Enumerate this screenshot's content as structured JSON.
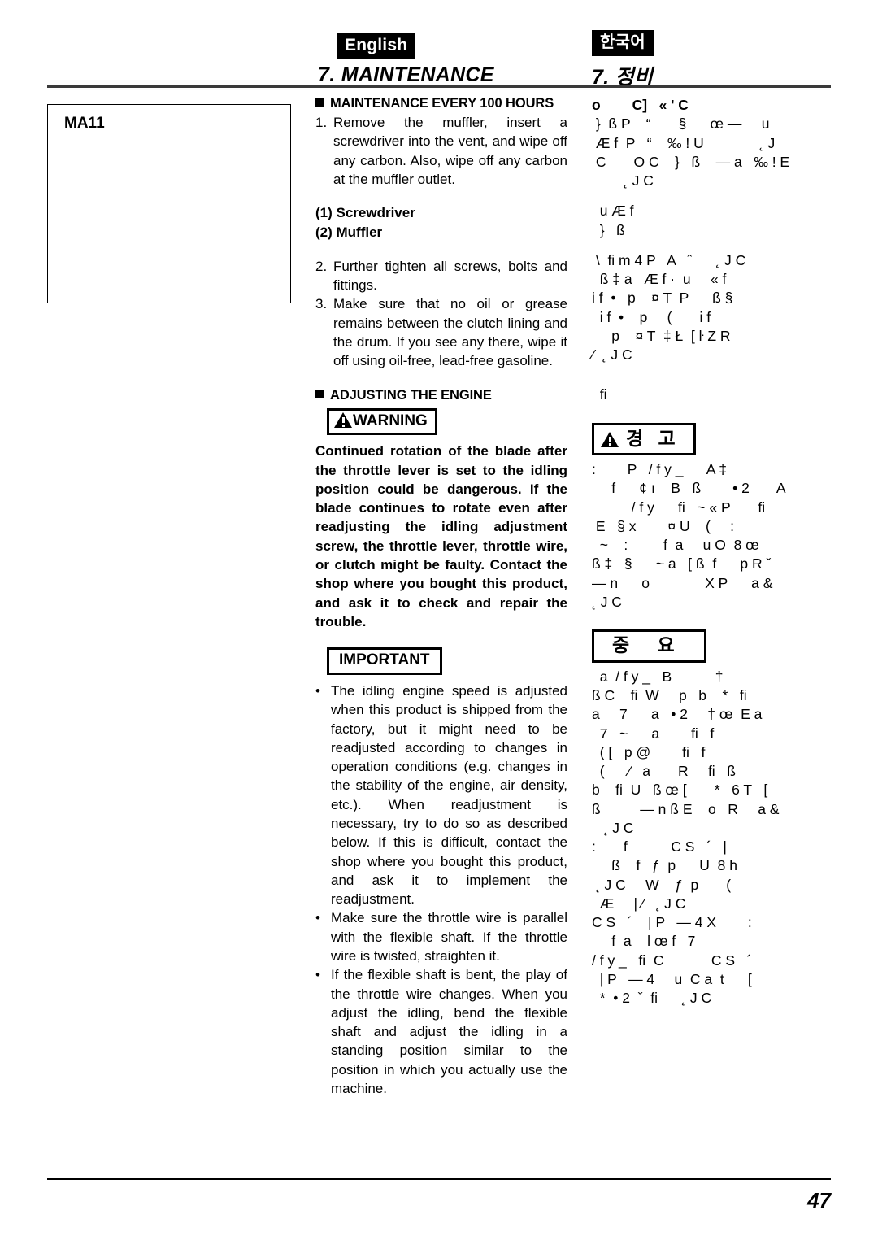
{
  "header": {
    "english_tag": "English",
    "korean_tag": "한국어",
    "english_chapter": "7. MAINTENANCE",
    "korean_chapter": "7. 정비"
  },
  "figure": {
    "label": "MA11"
  },
  "english": {
    "section_1_heading": "MAINTENANCE EVERY 100 HOURS",
    "steps": [
      {
        "number": "1.",
        "text": "Remove the muffler, insert a screwdriver into the vent, and wipe off any carbon. Also, wipe off any carbon at the muffler outlet."
      },
      {
        "number": "2.",
        "text": "Further tighten all screws, bolts and fittings."
      },
      {
        "number": "3.",
        "text": "Make sure that no oil or grease remains between the clutch lining and the drum. If you see any there, wipe it off using oil-free, lead-free gasoline."
      }
    ],
    "callouts": [
      "(1) Screwdriver",
      "(2) Muffler"
    ],
    "section_2_heading": "ADJUSTING THE ENGINE",
    "warning_label": "WARNING",
    "warning_text": "Continued rotation of the blade after the throttle lever is set to the idling position could be dangerous. If the blade continues to rotate even after readjusting the idling adjustment screw, the throttle lever, throttle wire, or clutch might be faulty. Contact the shop where you bought this product, and ask it to check and repair the trouble.",
    "important_label": "IMPORTANT",
    "important_bullets": [
      "The idling engine speed is adjusted when this product is shipped from the factory, but it might need to be readjusted according to changes in operation conditions (e.g. changes in the stability of the engine, air density, etc.). When readjustment is necessary, try to do so as described below. If this is difficult, contact the shop where you bought this product, and ask it to implement the readjustment.",
      "Make sure the throttle wire is parallel with the flexible shaft. If the throttle wire is twisted, straighten it.",
      "If the flexible shaft is bent, the play of the throttle wire changes. When you adjust the idling, bend the flexible shaft and adjust the idling in a standing position similar to the position in which you actually use the machine."
    ]
  },
  "korean": {
    "section_1_lines": [
      "o        C]   « ' C",
      " }  ß P    “       §      œ —     u",
      " Æ f  P   “    ‰ ! U              ˛ J",
      " C       O C    }   ß    — a   ‰ ! E",
      "        ˛ J C"
    ],
    "callout_lines": [
      "  u Æ f",
      "  }   ß"
    ],
    "section_2_lines": [
      " \\  fi m 4 P   A   ˆ      ˛ J C",
      "  ß ‡ a   Æ f ·  u     « f",
      "i f  •   p    ¤ T  P      ß §",
      "  i f  •    p     (       i f",
      "     p    ¤ T  ‡ Ł  [ ŀ Z R",
      "⁄  ˛ J C"
    ],
    "section_2_tail": "  fi",
    "warning_label": "경 고",
    "warning_lines": [
      ":        P   / f y _      A ‡",
      "     f      ¢ ı    B   ß        • 2       A",
      "          / f y      fi   ~ « P       fi",
      " E   § x        ¤ U    (     :",
      "  ~    :         f  a     u O  8 œ",
      "ß ‡   §      ~ a   [ ß  f      p R ˇ",
      "— n      o              X P      a &",
      "˛ J C"
    ],
    "important_label": "중 요",
    "important_lines": [
      "  a  / f y _   B           †",
      "ß C    fi  W     p   b    *   fi",
      "a     7      a   • 2     † œ  E a",
      "  7   ~      a        fi   f",
      "  ( [   p @        fi   f",
      "  (      ⁄   a       R     fi   ß",
      "b    fi  U   ß œ [       *   6 T   [",
      "ß          — n ß E    o   R     a &",
      "   ˛ J C",
      ":       f           C S   ´   |",
      "     ß    f   ƒ  p      U  8 h",
      " ˛ J C     W    ƒ  p       (",
      "  Æ     | ⁄   ˛ J C",
      "C S   ´    | P   — 4 X        :",
      "     f  a    l œ f   7",
      "/ f y _   fi  C            C S   ´",
      "  | P   — 4     u  C a  t      [",
      "  *  • 2  ˇ  fi      ˛ J C"
    ]
  },
  "footer": {
    "page_number": "47"
  }
}
